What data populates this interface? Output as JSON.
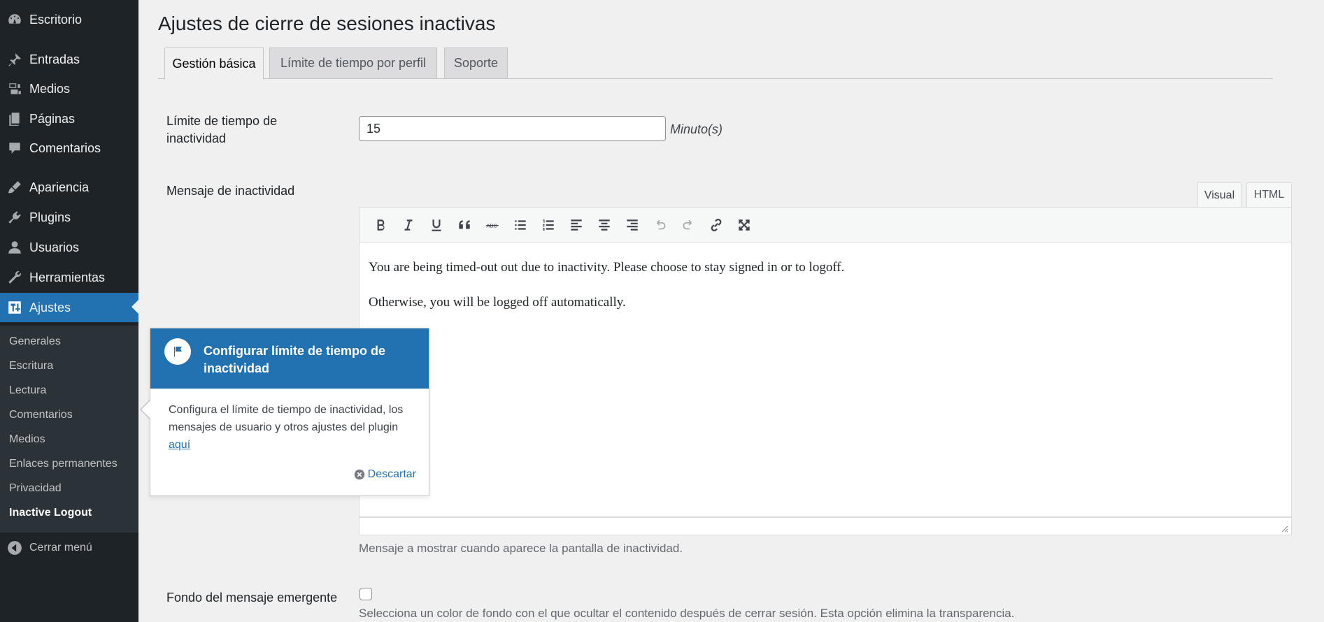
{
  "sidebar": {
    "items": [
      {
        "label": "Escritorio",
        "icon": "dashboard-icon"
      },
      {
        "label": "Entradas",
        "icon": "pin-icon"
      },
      {
        "label": "Medios",
        "icon": "media-icon"
      },
      {
        "label": "Páginas",
        "icon": "pages-icon"
      },
      {
        "label": "Comentarios",
        "icon": "comments-icon"
      },
      {
        "label": "Apariencia",
        "icon": "brush-icon"
      },
      {
        "label": "Plugins",
        "icon": "plugin-icon"
      },
      {
        "label": "Usuarios",
        "icon": "user-icon"
      },
      {
        "label": "Herramientas",
        "icon": "wrench-icon"
      },
      {
        "label": "Ajustes",
        "icon": "settings-icon"
      }
    ],
    "submenu": [
      "Generales",
      "Escritura",
      "Lectura",
      "Comentarios",
      "Medios",
      "Enlaces permanentes",
      "Privacidad",
      "Inactive Logout"
    ],
    "collapse_label": "Cerrar menú"
  },
  "page": {
    "title": "Ajustes de cierre de sesiones inactivas",
    "tabs": [
      "Gestión básica",
      "Límite de tiempo por perfil",
      "Soporte"
    ]
  },
  "form": {
    "timeout_label": "Límite de tiempo de inactividad",
    "timeout_value": "15",
    "timeout_unit": "Minuto(s)",
    "message_label": "Mensaje de inactividad",
    "editor_tabs": [
      "Visual",
      "HTML"
    ],
    "editor_paragraphs": [
      "You are being timed-out out due to inactivity. Please choose to stay signed in or to logoff.",
      "Otherwise, you will be logged off automatically."
    ],
    "message_help": "Mensaje a mostrar cuando aparece la pantalla de inactividad.",
    "background_label": "Fondo del mensaje emergente",
    "background_help": "Selecciona un color de fondo con el que ocultar el contenido después de cerrar sesión. Esta opción elimina la transparencia."
  },
  "pointer": {
    "title": "Configurar límite de tiempo de inactividad",
    "body": "Configura el límite de tiempo de inactividad, los mensajes de usuario y otros ajustes del plugin",
    "link": "aquí",
    "dismiss": "Descartar"
  },
  "colors": {
    "sidebar_bg": "#1d2327",
    "submenu_bg": "#2c3338",
    "accent": "#2271b1",
    "page_bg": "#f0f0f1"
  }
}
